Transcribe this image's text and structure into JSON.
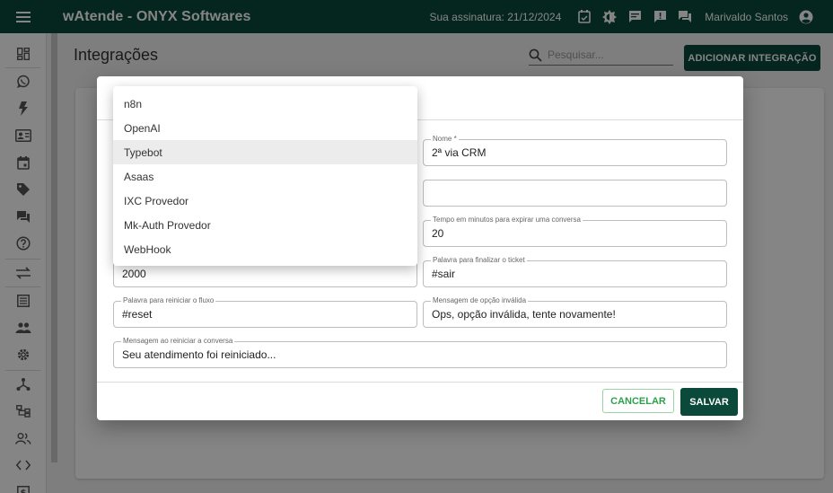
{
  "topbar": {
    "title": "wAtende - ONYX Softwares",
    "subscription": "Sua assinatura: 21/12/2024",
    "user_name": "Marivaldo Santos",
    "background": "#0b4a3a"
  },
  "page": {
    "title": "Integrações",
    "search_placeholder": "Pesquisar...",
    "add_button": "ADICIONAR INTEGRAÇÃO"
  },
  "dialog": {
    "fields": {
      "nome_label": "Nome *",
      "nome_value": "2ª via CRM",
      "field2_value": "",
      "tempo_label": "Tempo em minutos para expirar uma conversa",
      "tempo_value": "20",
      "delay_value": "2000",
      "finalizar_label": "Palavra para finalizar o ticket",
      "finalizar_value": "#sair",
      "reiniciar_label": "Palavra para reiniciar o fluxo",
      "reiniciar_value": "#reset",
      "invalida_label": "Mensagem de opção inválida",
      "invalida_value": "Ops, opção inválida, tente novamente!",
      "msg_reiniciar_label": "Mensagem ao reiniciar a conversa",
      "msg_reiniciar_value": "Seu atendimento foi reiniciado..."
    },
    "cancel_label": "CANCELAR",
    "save_label": "SALVAR"
  },
  "dropdown": {
    "options": [
      "n8n",
      "OpenAI",
      "Typebot",
      "Asaas",
      "IXC Provedor",
      "Mk-Auth Provedor",
      "WebHook"
    ],
    "selected": "Typebot"
  },
  "icons": {
    "menu": "menu-icon",
    "calendar_check": "calendar-check-icon",
    "theme": "theme-icon",
    "chat": "chat-icon",
    "alert": "alert-icon",
    "forum": "forum-icon",
    "account": "account-circle-icon",
    "search": "search-icon"
  }
}
